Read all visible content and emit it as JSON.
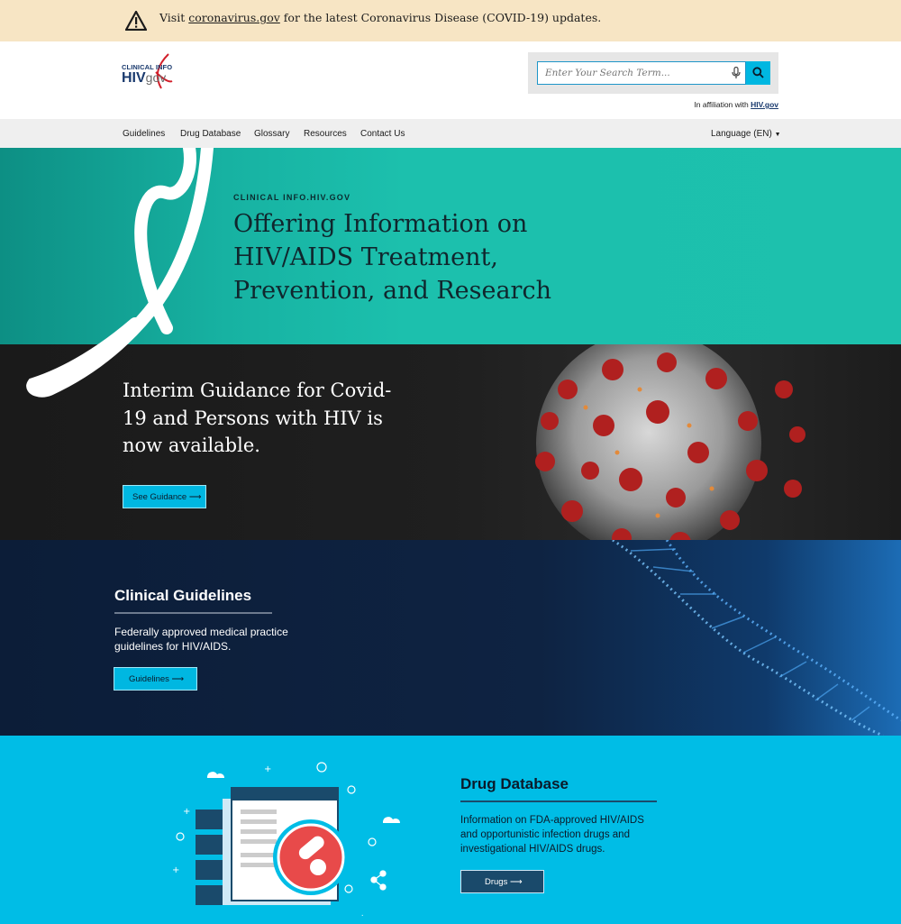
{
  "alert": {
    "prefix": "Visit ",
    "link": "coronavirus.gov",
    "suffix": " for the latest Coronavirus Disease (COVID-19) updates.",
    "icon": "warning-icon"
  },
  "header": {
    "logo_top": "CLINICAL INFO",
    "logo_hiv": "HIV",
    "logo_gov": "gov",
    "search_placeholder": "Enter Your Search Term...",
    "affiliation_prefix": "In affiliation with ",
    "affiliation_link": "HIV.gov"
  },
  "nav": {
    "items": [
      "Guidelines",
      "Drug Database",
      "Glossary",
      "Resources",
      "Contact Us"
    ],
    "language": "Language (EN)"
  },
  "hero": {
    "kicker": "CLINICAL INFO.HIV.GOV",
    "title": "Offering Information on HIV/AIDS Treatment, Prevention, and Research"
  },
  "covid": {
    "heading": "Interim Guidance for Covid-19 and Persons with HIV is now available.",
    "button": "See Guidance"
  },
  "clinical": {
    "heading": "Clinical Guidelines",
    "description": "Federally approved medical practice guidelines for HIV/AIDS.",
    "button": "Guidelines"
  },
  "drug": {
    "heading": "Drug Database",
    "description": "Information on FDA-approved HIV/AIDS and opportunistic infection drugs and investigational HIV/AIDS drugs.",
    "button": "Drugs"
  },
  "colors": {
    "alert_bg": "#f7e5c4",
    "teal": "#1dc1ad",
    "cyan": "#00b7e1",
    "navy": "#0e2342",
    "drug_bg": "#00bde6"
  }
}
